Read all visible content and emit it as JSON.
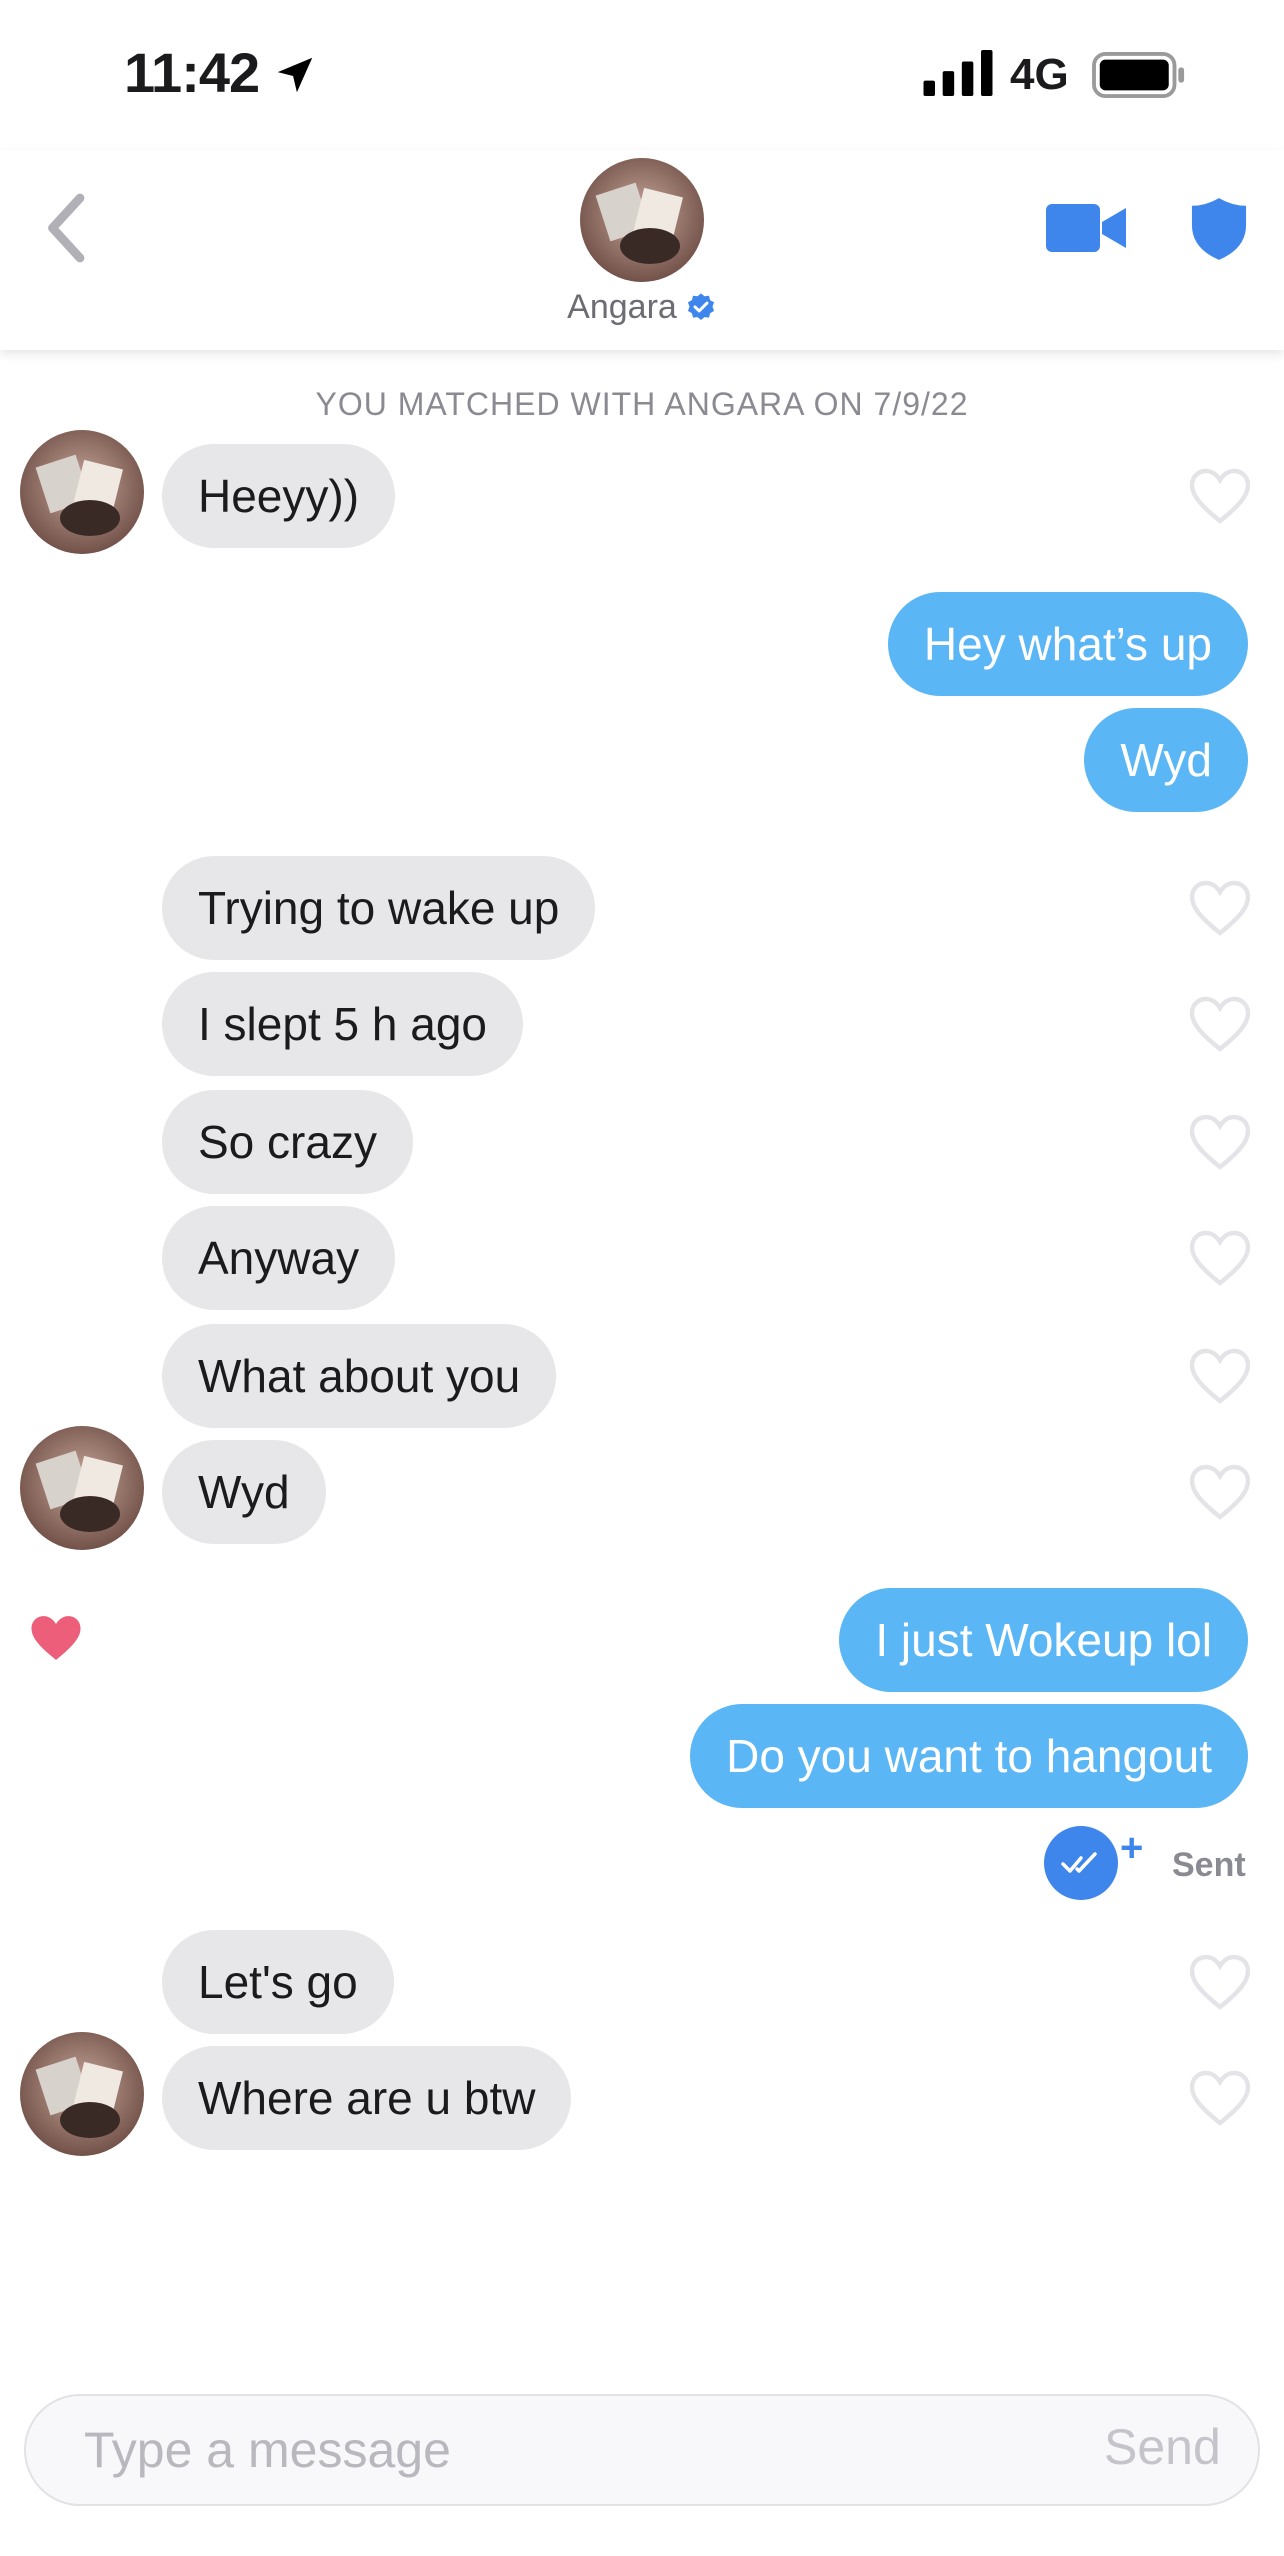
{
  "status_bar": {
    "time": "11:42",
    "network": "4G",
    "icons": [
      "location-arrow-icon",
      "signal-bars-icon",
      "battery-icon"
    ]
  },
  "header": {
    "name": "Angara",
    "verified": true,
    "icons": [
      "back-chevron-icon",
      "video-call-icon",
      "safety-shield-icon"
    ],
    "accent_color": "#3e86ec"
  },
  "chat": {
    "match_note": "YOU MATCHED WITH ANGARA ON 7/9/22",
    "messages": [
      {
        "from": "them",
        "text": "Heeyy))"
      },
      {
        "from": "me",
        "text": "Hey what’s up"
      },
      {
        "from": "me",
        "text": "Wyd"
      },
      {
        "from": "them",
        "text": "Trying to wake up"
      },
      {
        "from": "them",
        "text": "I slept 5 h ago"
      },
      {
        "from": "them",
        "text": "So crazy"
      },
      {
        "from": "them",
        "text": "Anyway"
      },
      {
        "from": "them",
        "text": "What about you"
      },
      {
        "from": "them",
        "text": "Wyd"
      },
      {
        "from": "me",
        "text": "I just Wokeup lol",
        "liked": true
      },
      {
        "from": "me",
        "text": "Do you want to hangout"
      },
      {
        "from": "them",
        "text": "Let's go"
      },
      {
        "from": "them",
        "text": "Where are u btw"
      }
    ],
    "sent_status": "Sent",
    "sent_plus": "+",
    "colors": {
      "incoming_bubble": "#e7e7ea",
      "outgoing_bubble": "#5bb6f5",
      "liked_heart": "#ec5e7a"
    }
  },
  "composer": {
    "placeholder": "Type a message",
    "send_label": "Send"
  }
}
